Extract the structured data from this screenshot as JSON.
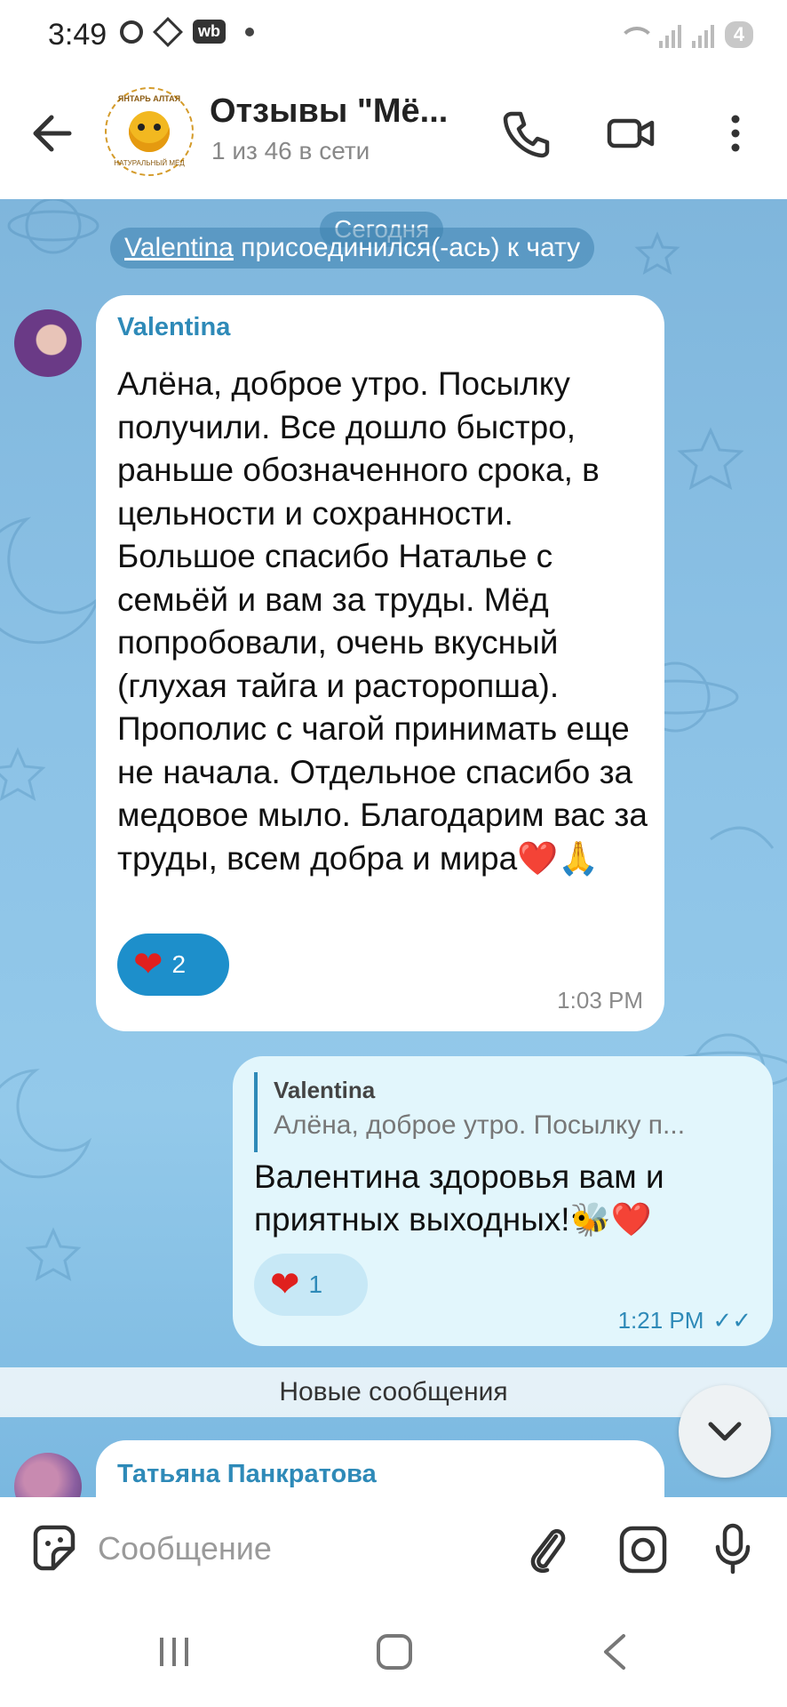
{
  "status_bar": {
    "time": "3:49",
    "wb_badge": "wb",
    "battery_level": "4"
  },
  "header": {
    "title": "Отзывы \"Мё...",
    "subtitle": "1 из 46 в сети",
    "logo_text_top": "ЯНТАРЬ АЛТАЯ",
    "logo_text_bottom": "НАТУРАЛЬНЫЙ МЁД"
  },
  "chat": {
    "date_label": "Сегодня",
    "service_message": {
      "user": "Valentina",
      "action": " присоединился(-ась) к чату"
    },
    "messages": [
      {
        "sender": "Valentina",
        "text": "Алёна, доброе утро. Посылку получили. Все дошло быстро, раньше обозначенного срока, в цельности и сохранности. Большое спасибо Наталье с семьёй и вам за труды. Мёд попробовали, очень вкусный (глухая тайга и расторопша). Прополис с чагой принимать еще не начала. Отдельное спасибо за медовое мыло. Благодарим вас за труды, всем добра и мира❤️🙏",
        "reaction_emoji": "❤",
        "reaction_count": "2",
        "time": "1:03 PM"
      },
      {
        "reply_to_name": "Valentina",
        "reply_to_text": "Алёна, доброе утро. Посылку п...",
        "text": "Валентина здоровья вам и приятных выходных!🐝❤️",
        "reaction_emoji": "❤",
        "reaction_count": "1",
        "time": "1:21 PM",
        "checks": "✓✓"
      },
      {
        "sender": "Татьяна Панкратова"
      }
    ],
    "new_messages_label": "Новые сообщения"
  },
  "input": {
    "placeholder": "Сообщение"
  },
  "icons": {
    "back": "arrow-left-icon",
    "call": "phone-icon",
    "video": "video-camera-icon",
    "more": "more-vertical-icon",
    "sticker": "sticker-icon",
    "attach": "paperclip-icon",
    "camera": "instagram-camera-icon",
    "mic": "microphone-icon",
    "scroll_down": "chevron-down-icon"
  },
  "colors": {
    "accent": "#2e8ab8",
    "reaction_active": "#1d8fcb",
    "outgoing_bubble": "#e2f6fc",
    "chat_background": "#8cc2e6"
  }
}
